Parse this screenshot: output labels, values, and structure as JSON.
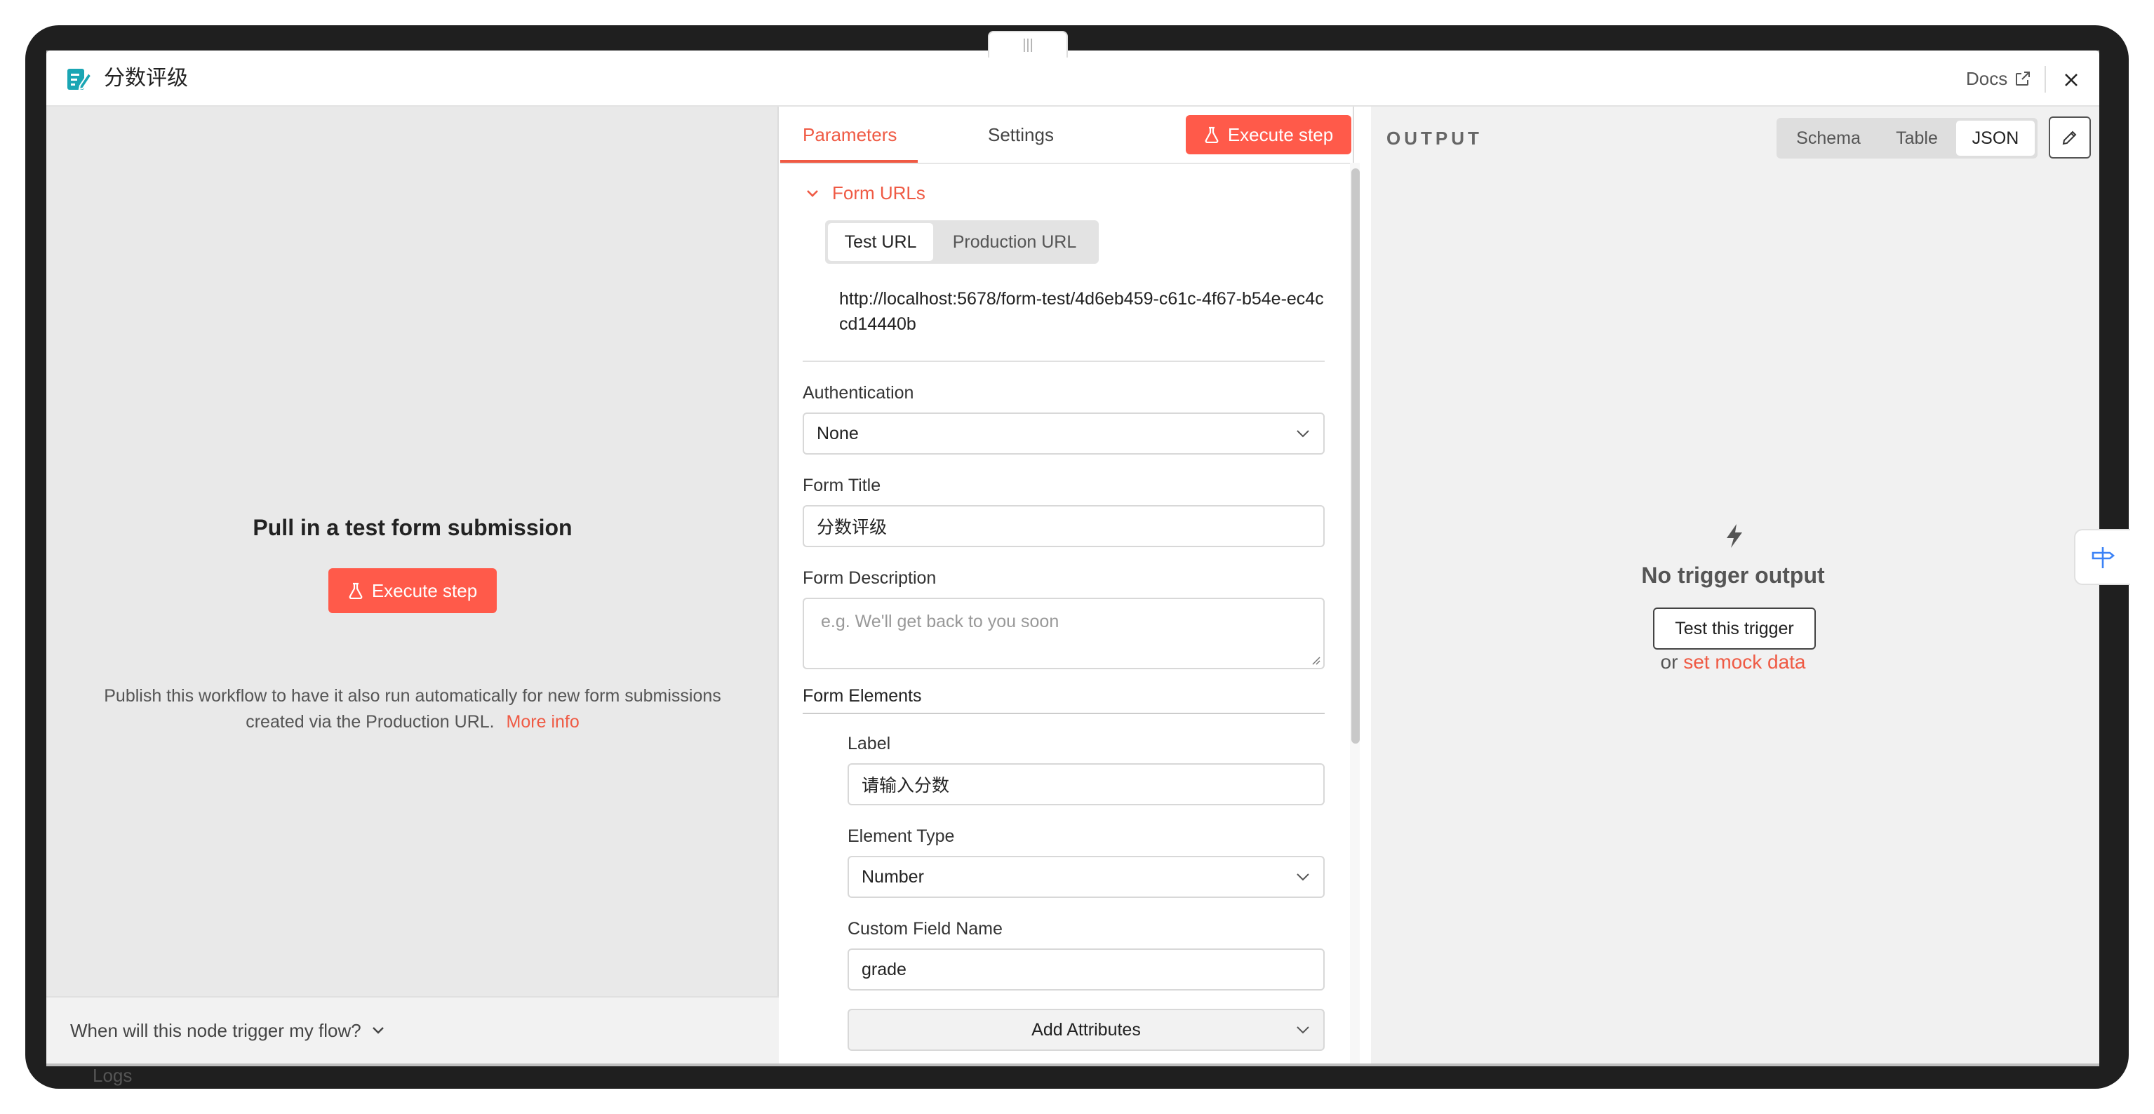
{
  "header": {
    "title": "分数评级",
    "docs_label": "Docs",
    "handle_glyph": "|||"
  },
  "left_panel": {
    "heading": "Pull in a test form submission",
    "execute_label": "Execute step",
    "description": "Publish this workflow to have it also run automatically for new form submissions created via the Production URL.",
    "more_info": "More info",
    "footer_question": "When will this node trigger my flow?"
  },
  "middle_panel": {
    "tabs": [
      {
        "label": "Parameters"
      },
      {
        "label": "Settings"
      }
    ],
    "execute_label": "Execute step",
    "form_urls": {
      "section_label": "Form URLs",
      "toggle_options": [
        "Test URL",
        "Production URL"
      ],
      "url": "http://localhost:5678/form-test/4d6eb459-c61c-4f67-b54e-ec4ccd14440b"
    },
    "authentication": {
      "label": "Authentication",
      "value": "None"
    },
    "form_title": {
      "label": "Form Title",
      "value": "分数评级"
    },
    "form_description": {
      "label": "Form Description",
      "placeholder": "e.g. We'll get back to you soon"
    },
    "form_elements": {
      "label": "Form Elements",
      "element_label": {
        "label": "Label",
        "value": "请输入分数"
      },
      "element_type": {
        "label": "Element Type",
        "value": "Number"
      },
      "custom_field_name": {
        "label": "Custom Field Name",
        "value": "grade"
      },
      "add_attributes": "Add Attributes"
    }
  },
  "right_panel": {
    "output_label": "OUTPUT",
    "views": [
      "Schema",
      "Table",
      "JSON"
    ],
    "active_view": "JSON",
    "no_output": "No trigger output",
    "test_trigger": "Test this trigger",
    "mock_prefix": "or",
    "mock_link": "set mock data"
  },
  "background": {
    "logs_label": "Logs"
  },
  "colors": {
    "accent": "#ff5a4a",
    "link": "#ef5a44",
    "panel_bg": "#e9e9e9",
    "output_bg": "#f1f1f1"
  }
}
